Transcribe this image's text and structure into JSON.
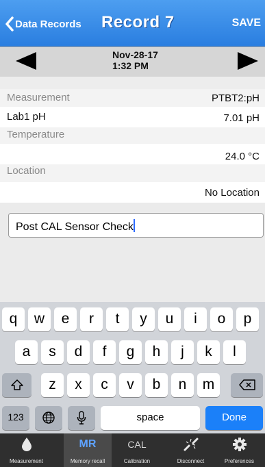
{
  "nav": {
    "back_label": "Data Records",
    "title": "Record 7",
    "save_label": "SAVE"
  },
  "date": {
    "date": "Nov-28-17",
    "time": "1:32 PM"
  },
  "record": {
    "measurement_label": "Measurement",
    "measurement_value": "PTBT2:pH",
    "sample_label": "Lab1 pH",
    "sample_value": "7.01 pH",
    "temperature_label": "Temperature",
    "temperature_value": "24.0 °C",
    "location_label": "Location",
    "location_value": "No Location"
  },
  "note_field": {
    "value": "Post CAL Sensor Check"
  },
  "keyboard": {
    "row1": [
      "q",
      "w",
      "e",
      "r",
      "t",
      "y",
      "u",
      "i",
      "o",
      "p"
    ],
    "row2": [
      "a",
      "s",
      "d",
      "f",
      "g",
      "h",
      "j",
      "k",
      "l"
    ],
    "row3": [
      "z",
      "x",
      "c",
      "v",
      "b",
      "n",
      "m"
    ],
    "numbers_label": "123",
    "space_label": "space",
    "done_label": "Done"
  },
  "tabs": [
    {
      "icon": "drop-icon",
      "label": "Measurement"
    },
    {
      "icon_text": "MR",
      "label": "Memory recall"
    },
    {
      "icon_text": "CAL",
      "label": "Calibration"
    },
    {
      "icon": "disconnect-icon",
      "label": "Disconnect"
    },
    {
      "icon": "gear-icon",
      "label": "Preferences"
    }
  ],
  "colors": {
    "nav_blue": "#2a7ee0",
    "done_blue": "#1b80f9",
    "active_tab_accent": "#5ea2ff"
  }
}
